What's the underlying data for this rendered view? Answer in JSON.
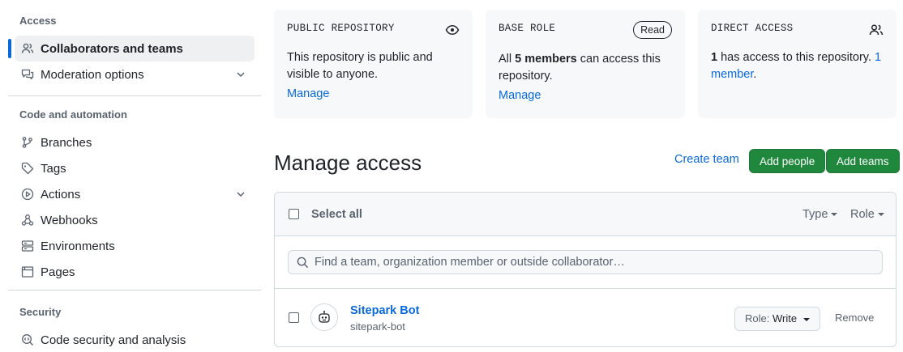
{
  "sidebar": {
    "access_heading": "Access",
    "access_items": [
      {
        "label": "Collaborators and teams",
        "icon": "people-icon",
        "active": true
      },
      {
        "label": "Moderation options",
        "icon": "comment-discussion-icon",
        "expandable": true
      }
    ],
    "code_heading": "Code and automation",
    "code_items": [
      {
        "label": "Branches",
        "icon": "git-branch-icon"
      },
      {
        "label": "Tags",
        "icon": "tag-icon"
      },
      {
        "label": "Actions",
        "icon": "play-icon",
        "expandable": true
      },
      {
        "label": "Webhooks",
        "icon": "webhook-icon"
      },
      {
        "label": "Environments",
        "icon": "server-icon"
      },
      {
        "label": "Pages",
        "icon": "browser-icon"
      }
    ],
    "security_heading": "Security",
    "security_items": [
      {
        "label": "Code security and analysis",
        "icon": "codescan-icon"
      }
    ]
  },
  "cards": {
    "public": {
      "label": "PUBLIC REPOSITORY",
      "text": "This repository is public and visible to anyone.",
      "link": "Manage",
      "icon": "eye-icon"
    },
    "base_role": {
      "label": "BASE ROLE",
      "badge": "Read",
      "text_pre": "All ",
      "text_strong": "5 members",
      "text_post": " can access this repository.",
      "link": "Manage"
    },
    "direct": {
      "label": "DIRECT ACCESS",
      "icon": "people-icon",
      "text_strong": "1",
      "text_mid": " has access to this repository. ",
      "text_link": "1 member",
      "text_end": "."
    }
  },
  "manage": {
    "title": "Manage access",
    "create_team": "Create team",
    "add_people": "Add people",
    "add_teams": "Add teams"
  },
  "list": {
    "select_all": "Select all",
    "type_filter": "Type",
    "role_filter": "Role",
    "search_placeholder": "Find a team, organization member or outside collaborator…",
    "members": [
      {
        "name": "Sitepark Bot",
        "login": "sitepark-bot",
        "role_prefix": "Role:",
        "role": "Write",
        "remove": "Remove"
      }
    ]
  },
  "colors": {
    "accent": "#0969da",
    "primary_button": "#1f883d",
    "card_bg": "#f6f8fa",
    "border": "#d1d9e0"
  }
}
